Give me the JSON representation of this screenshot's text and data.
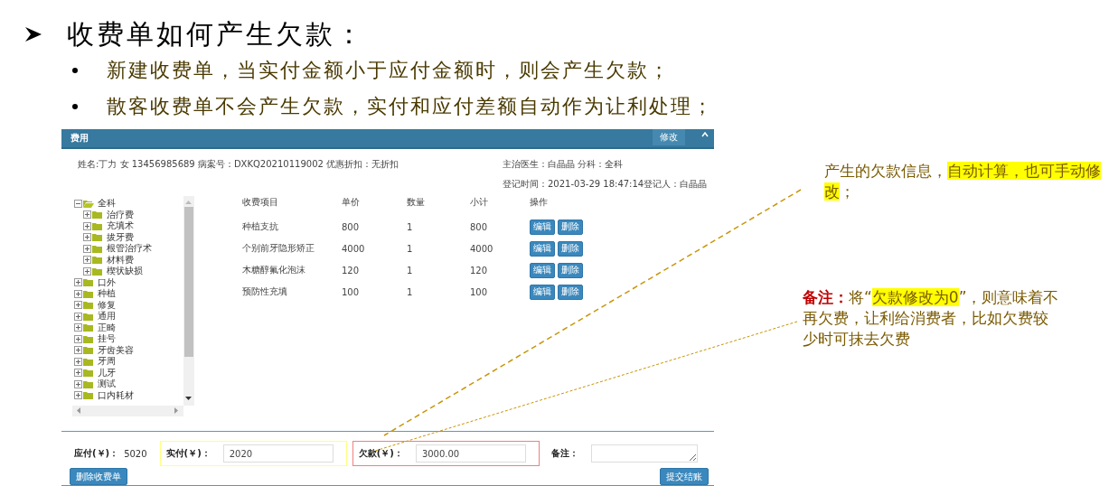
{
  "slide": {
    "heading": "收费单如何产生欠款：",
    "bullets": [
      "新建收费单，当实付金额小于应付金额时，则会产生欠款；",
      "散客收费单不会产生欠款，实付和应付差额自动作为让利处理；"
    ]
  },
  "panel": {
    "title": "费用",
    "edit_button": "修改",
    "info": {
      "patient": "姓名:丁力 女 13456985689 病案号：DXKQ20210119002 优惠折扣：无折扣",
      "doctor": "主治医生：白晶晶 分科：全科",
      "registered": "登记时间：2021-03-29 18:47:14登记人：白晶晶"
    },
    "tree": [
      {
        "label": "全科",
        "expanded": true,
        "children": [
          {
            "label": "治疗费",
            "expanded": false
          },
          {
            "label": "充填术",
            "expanded": false
          },
          {
            "label": "拔牙费",
            "expanded": false
          },
          {
            "label": "根管治疗术",
            "expanded": false
          },
          {
            "label": "材料费",
            "expanded": false
          },
          {
            "label": "楔状缺损",
            "expanded": false
          }
        ]
      },
      {
        "label": "口外",
        "expanded": false
      },
      {
        "label": "种植",
        "expanded": false
      },
      {
        "label": "修复",
        "expanded": false
      },
      {
        "label": "通用",
        "expanded": false
      },
      {
        "label": "正畸",
        "expanded": false
      },
      {
        "label": "挂号",
        "expanded": false
      },
      {
        "label": "牙齿美容",
        "expanded": false
      },
      {
        "label": "牙周",
        "expanded": false
      },
      {
        "label": "儿牙",
        "expanded": false
      },
      {
        "label": "测试",
        "expanded": false
      },
      {
        "label": "口内耗材",
        "expanded": false
      }
    ],
    "table": {
      "columns": [
        "收费项目",
        "单价",
        "数量",
        "小计",
        "操作"
      ],
      "rows": [
        {
          "item": "种植支抗",
          "price": "800",
          "qty": "1",
          "subtotal": "800",
          "actions": [
            "编辑",
            "删除"
          ]
        },
        {
          "item": "个别前牙隐形矫正",
          "price": "4000",
          "qty": "1",
          "subtotal": "4000",
          "actions": [
            "编辑",
            "删除"
          ]
        },
        {
          "item": "木糖醇氟化泡沫",
          "price": "120",
          "qty": "1",
          "subtotal": "120",
          "actions": [
            "编辑",
            "删除"
          ]
        },
        {
          "item": "预防性充填",
          "price": "100",
          "qty": "1",
          "subtotal": "100",
          "actions": [
            "编辑",
            "删除"
          ]
        }
      ]
    },
    "payable": {
      "label": "应付(￥)：",
      "value": "5020"
    },
    "fields": [
      {
        "label": "实付(￥)：",
        "value": "2020",
        "color": "#ffff80"
      },
      {
        "label": "欠款(￥)：",
        "value": "3000.00",
        "color": "#f08080"
      },
      {
        "label": "备注："
      }
    ],
    "buttons": [
      "删除收费单",
      "提交结账"
    ]
  },
  "notes": [
    {
      "segments": [
        {
          "text": "产生的欠款信息，",
          "highlight": false
        },
        {
          "text": "自动计算，也可手动修改",
          "highlight": true
        },
        {
          "text": "；",
          "highlight": false
        }
      ]
    },
    {
      "label": "备注：",
      "segments": [
        {
          "text": "将“",
          "highlight": false
        },
        {
          "text": "欠款修改为0",
          "highlight": true
        },
        {
          "text": "”，则意味着不再欠费，让利给消费者，比如欠费较少时可抹去欠费",
          "highlight": false
        }
      ]
    }
  ]
}
